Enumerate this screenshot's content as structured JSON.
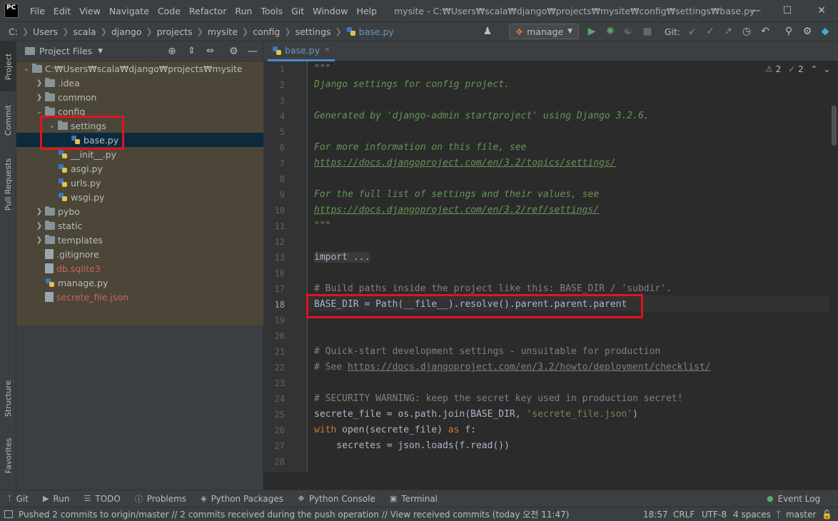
{
  "app": {
    "logo": "PC",
    "window_title": "mysite - C:₩Users₩scala₩django₩projects₩mysite₩config₩settings₩base.py"
  },
  "menu": [
    "File",
    "Edit",
    "View",
    "Navigate",
    "Code",
    "Refactor",
    "Run",
    "Tools",
    "Git",
    "Window",
    "Help"
  ],
  "breadcrumbs": [
    "C:",
    "Users",
    "scala",
    "django",
    "projects",
    "mysite",
    "config",
    "settings",
    "base.py"
  ],
  "run_config": "manage",
  "git_label": "Git:",
  "left_tabs": {
    "project": "Project",
    "commit": "Commit",
    "pull_requests": "Pull Requests",
    "structure": "Structure",
    "favorites": "Favorites"
  },
  "project_panel": {
    "title": "Project Files",
    "tree": [
      {
        "label": "C:₩Users₩scala₩django₩projects₩mysite",
        "type": "folder",
        "depth": 0,
        "expanded": true
      },
      {
        "label": ".idea",
        "type": "folder",
        "depth": 1,
        "expanded": false
      },
      {
        "label": "common",
        "type": "folder",
        "depth": 1,
        "expanded": false
      },
      {
        "label": "config",
        "type": "folder",
        "depth": 1,
        "expanded": true
      },
      {
        "label": "settings",
        "type": "folder",
        "depth": 2,
        "expanded": true
      },
      {
        "label": "base.py",
        "type": "py",
        "depth": 3,
        "selected": true
      },
      {
        "label": "__init__.py",
        "type": "py",
        "depth": 2
      },
      {
        "label": "asgi.py",
        "type": "py",
        "depth": 2
      },
      {
        "label": "urls.py",
        "type": "py",
        "depth": 2
      },
      {
        "label": "wsgi.py",
        "type": "py",
        "depth": 2
      },
      {
        "label": "pybo",
        "type": "folder",
        "depth": 1,
        "expanded": false
      },
      {
        "label": "static",
        "type": "folder",
        "depth": 1,
        "expanded": false
      },
      {
        "label": "templates",
        "type": "folder",
        "depth": 1,
        "expanded": false
      },
      {
        "label": ".gitignore",
        "type": "file",
        "depth": 1
      },
      {
        "label": "db.sqlite3",
        "type": "file",
        "depth": 1,
        "untracked": true
      },
      {
        "label": "manage.py",
        "type": "py",
        "depth": 1
      },
      {
        "label": "secrete_file.json",
        "type": "file",
        "depth": 1,
        "untracked": true
      }
    ]
  },
  "editor": {
    "tab_label": "base.py",
    "inspections": {
      "warnings": "2",
      "typos": "2"
    },
    "current_line": "18",
    "lines": [
      {
        "n": "1",
        "parts": [
          {
            "t": "\"\"\"",
            "c": "doc"
          }
        ]
      },
      {
        "n": "2",
        "parts": [
          {
            "t": "Django settings for config project.",
            "c": "doc"
          }
        ]
      },
      {
        "n": "3",
        "parts": []
      },
      {
        "n": "4",
        "parts": [
          {
            "t": "Generated by 'django-admin startproject' using Django 3.2.6.",
            "c": "doc"
          }
        ]
      },
      {
        "n": "5",
        "parts": []
      },
      {
        "n": "6",
        "parts": [
          {
            "t": "For more information on this file, see",
            "c": "doc"
          }
        ]
      },
      {
        "n": "7",
        "parts": [
          {
            "t": "https://docs.djangoproject.com/en/3.2/topics/settings/",
            "c": "doclink"
          }
        ]
      },
      {
        "n": "8",
        "parts": []
      },
      {
        "n": "9",
        "parts": [
          {
            "t": "For the full list of settings and their values, see",
            "c": "doc"
          }
        ]
      },
      {
        "n": "10",
        "parts": [
          {
            "t": "https://docs.djangoproject.com/en/3.2/ref/settings/",
            "c": "doclink"
          }
        ]
      },
      {
        "n": "11",
        "parts": [
          {
            "t": "\"\"\"",
            "c": "doc"
          }
        ]
      },
      {
        "n": "12",
        "parts": []
      },
      {
        "n": "13",
        "parts": [
          {
            "t": "import ...",
            "c": "fold"
          }
        ]
      },
      {
        "n": "16",
        "parts": []
      },
      {
        "n": "17",
        "parts": [
          {
            "t": "# Build paths inside the project like this: BASE_DIR / 'subdir'.",
            "c": "cmt"
          }
        ]
      },
      {
        "n": "18",
        "parts": [
          {
            "t": "BASE_DIR = Path(__file__).resolve().parent.parent.parent",
            "c": "plain"
          }
        ]
      },
      {
        "n": "19",
        "parts": []
      },
      {
        "n": "20",
        "parts": []
      },
      {
        "n": "21",
        "parts": [
          {
            "t": "# Quick-start development settings - unsuitable for production",
            "c": "cmt"
          }
        ]
      },
      {
        "n": "22",
        "parts": [
          {
            "t": "# See ",
            "c": "cmt"
          },
          {
            "t": "https://docs.djangoproject.com/en/3.2/howto/deployment/checklist/",
            "c": "cmtlink"
          }
        ]
      },
      {
        "n": "23",
        "parts": []
      },
      {
        "n": "24",
        "parts": [
          {
            "t": "# SECURITY WARNING: keep the secret key used in production secret!",
            "c": "cmt"
          }
        ]
      },
      {
        "n": "25",
        "parts": [
          {
            "t": "secrete_file = os.path.join(BASE_DIR, ",
            "c": "plain"
          },
          {
            "t": "'secrete_file.json'",
            "c": "str"
          },
          {
            "t": ")",
            "c": "plain"
          }
        ]
      },
      {
        "n": "26",
        "parts": [
          {
            "t": "with ",
            "c": "kw"
          },
          {
            "t": "open(secrete_file) ",
            "c": "plain"
          },
          {
            "t": "as ",
            "c": "kw"
          },
          {
            "t": "f:",
            "c": "plain"
          }
        ]
      },
      {
        "n": "27",
        "parts": [
          {
            "t": "    secretes = json.loads(f.read())",
            "c": "plain"
          }
        ]
      },
      {
        "n": "28",
        "parts": []
      }
    ]
  },
  "bottom_tools": [
    "Git",
    "Run",
    "TODO",
    "Problems",
    "Python Packages",
    "Python Console",
    "Terminal"
  ],
  "event_log": "Event Log",
  "status": {
    "message": "Pushed 2 commits to origin/master // 2 commits received during the push operation // View received commits (today 오전 11:47)",
    "position": "18:57",
    "line_sep": "CRLF",
    "encoding": "UTF-8",
    "indent": "4 spaces",
    "branch": "master"
  },
  "colors": {
    "highlight_box": "#e0141e",
    "selection": "#0d293e",
    "accent": "#4a88c7"
  }
}
